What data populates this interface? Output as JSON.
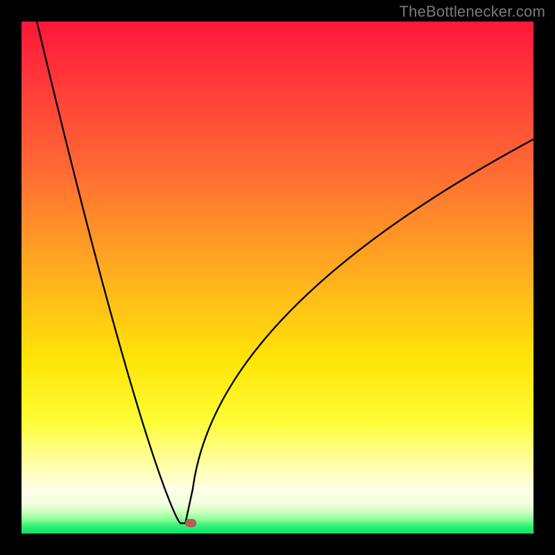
{
  "watermark": "TheBottlenecker.com",
  "chart_data": {
    "type": "line",
    "title": "",
    "xlabel": "",
    "ylabel": "",
    "xlim": [
      0,
      100
    ],
    "ylim": [
      0,
      100
    ],
    "grid": false,
    "legend": false,
    "curve": {
      "left_branch": {
        "x_start": 3,
        "y_start": 100,
        "x_end": 31,
        "y_end": 2,
        "shape": "near-linear descent then short flat segment near bottom"
      },
      "right_branch": {
        "x_start": 33,
        "y_start": 2,
        "x_end": 100,
        "y_end": 77,
        "shape": "monotone increasing, concave (sqrt-like), slope decreasing"
      },
      "minimum": {
        "x": 32,
        "y": 2
      }
    },
    "marker": {
      "x": 33,
      "y": 2,
      "color": "#b75d55"
    },
    "background_gradient": {
      "type": "vertical",
      "description": "red at top through orange/yellow to very pale near bottom; thin bright green band at very bottom",
      "stops": [
        {
          "pos": 0.0,
          "color": "#ff173b"
        },
        {
          "pos": 0.12,
          "color": "#ff3a3a"
        },
        {
          "pos": 0.3,
          "color": "#ff6e33"
        },
        {
          "pos": 0.5,
          "color": "#ffb11e"
        },
        {
          "pos": 0.66,
          "color": "#ffe508"
        },
        {
          "pos": 0.78,
          "color": "#fdfd35"
        },
        {
          "pos": 0.86,
          "color": "#feffa0"
        },
        {
          "pos": 0.915,
          "color": "#ffffe8"
        },
        {
          "pos": 0.942,
          "color": "#f3ffe0"
        },
        {
          "pos": 0.958,
          "color": "#ccffbf"
        },
        {
          "pos": 0.972,
          "color": "#8bff9a"
        },
        {
          "pos": 0.985,
          "color": "#36f177"
        },
        {
          "pos": 1.0,
          "color": "#00e765"
        }
      ]
    }
  },
  "colors": {
    "frame": "#000000",
    "curve": "#000000",
    "marker": "#b75d55",
    "watermark": "#7a7a7a"
  }
}
